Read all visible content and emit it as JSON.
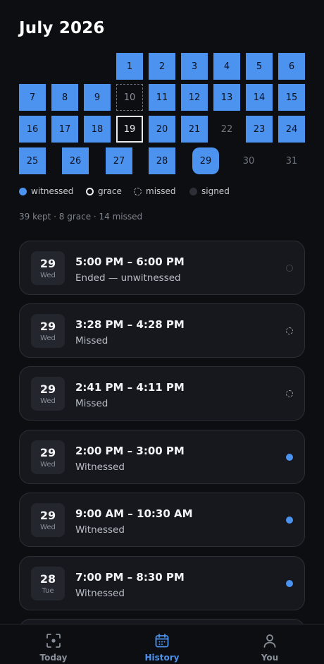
{
  "header": {
    "title": "July 2026"
  },
  "calendar": {
    "rows": [
      [
        {
          "day": "1",
          "state": "witnessed"
        },
        {
          "day": "2",
          "state": "witnessed"
        },
        {
          "day": "3",
          "state": "witnessed"
        },
        {
          "day": "4",
          "state": "witnessed"
        },
        {
          "day": "5",
          "state": "witnessed"
        },
        {
          "day": "6",
          "state": "witnessed"
        }
      ],
      [
        {
          "day": "7",
          "state": "witnessed"
        },
        {
          "day": "8",
          "state": "witnessed"
        },
        {
          "day": "9",
          "state": "witnessed"
        },
        {
          "day": "10",
          "state": "missed"
        },
        {
          "day": "11",
          "state": "witnessed"
        },
        {
          "day": "12",
          "state": "witnessed"
        },
        {
          "day": "13",
          "state": "witnessed"
        },
        {
          "day": "14",
          "state": "witnessed"
        },
        {
          "day": "15",
          "state": "witnessed"
        }
      ],
      [
        {
          "day": "16",
          "state": "witnessed"
        },
        {
          "day": "17",
          "state": "witnessed"
        },
        {
          "day": "18",
          "state": "witnessed"
        },
        {
          "day": "19",
          "state": "grace"
        },
        {
          "day": "20",
          "state": "witnessed"
        },
        {
          "day": "21",
          "state": "witnessed"
        },
        {
          "day": "22",
          "state": "plain"
        },
        {
          "day": "23",
          "state": "witnessed"
        },
        {
          "day": "24",
          "state": "witnessed"
        }
      ],
      [
        {
          "day": "25",
          "state": "witnessed"
        },
        {
          "day": "26",
          "state": "witnessed"
        },
        {
          "day": "27",
          "state": "witnessed"
        },
        {
          "day": "28",
          "state": "witnessed"
        },
        {
          "day": "29",
          "state": "today"
        },
        {
          "day": "30",
          "state": "plain"
        },
        {
          "day": "31",
          "state": "plain"
        }
      ]
    ]
  },
  "legend": {
    "witnessed": "witnessed",
    "grace": "grace",
    "missed": "missed",
    "signed": "signed"
  },
  "summary": "39 kept · 8 grace · 14 missed",
  "sessions": [
    {
      "day": "29",
      "weekday": "Wed",
      "time": "5:00 PM – 6:00 PM",
      "status": "Ended — unwitnessed",
      "indicator": "signed"
    },
    {
      "day": "29",
      "weekday": "Wed",
      "time": "3:28 PM – 4:28 PM",
      "status": "Missed",
      "indicator": "missed"
    },
    {
      "day": "29",
      "weekday": "Wed",
      "time": "2:41 PM – 4:11 PM",
      "status": "Missed",
      "indicator": "missed"
    },
    {
      "day": "29",
      "weekday": "Wed",
      "time": "2:00 PM – 3:00 PM",
      "status": "Witnessed",
      "indicator": "witnessed"
    },
    {
      "day": "29",
      "weekday": "Wed",
      "time": "9:00 AM – 10:30 AM",
      "status": "Witnessed",
      "indicator": "witnessed"
    },
    {
      "day": "28",
      "weekday": "Tue",
      "time": "7:00 PM – 8:30 PM",
      "status": "Witnessed",
      "indicator": "witnessed"
    }
  ],
  "tabs": [
    {
      "label": "Today",
      "icon": "focus-icon",
      "active": false
    },
    {
      "label": "History",
      "icon": "calendar-icon",
      "active": true
    },
    {
      "label": "You",
      "icon": "user-icon",
      "active": false
    }
  ]
}
